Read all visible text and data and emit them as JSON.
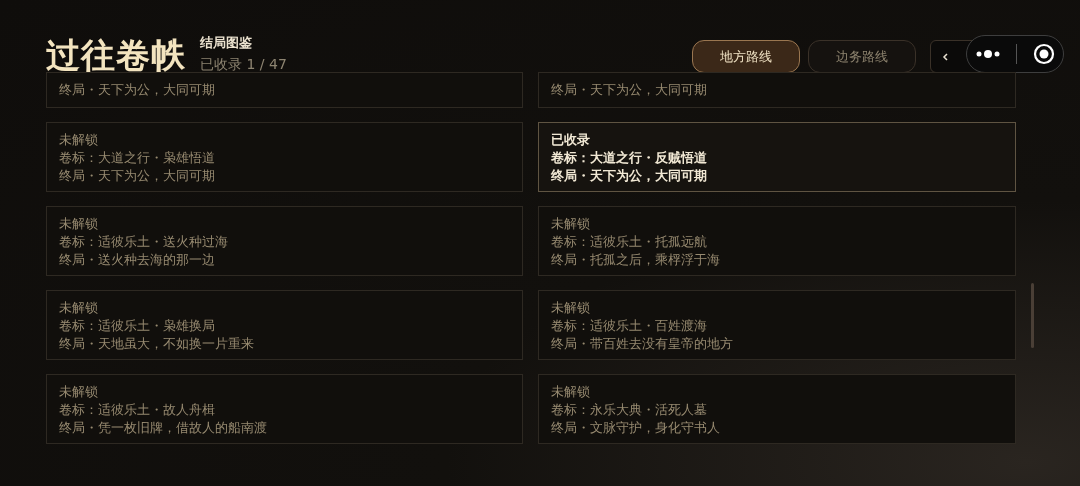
{
  "header": {
    "title": "过往卷帙",
    "subtitle": "结局图鉴",
    "progress": "已收录 1 / 47"
  },
  "tabs": [
    {
      "label": "地方路线",
      "selected": true
    },
    {
      "label": "边务路线",
      "selected": false
    }
  ],
  "cards": [
    {
      "kind": "clipped",
      "unlocked": false,
      "ending": "终局・天下为公，大同可期"
    },
    {
      "kind": "clipped",
      "unlocked": false,
      "ending": "终局・天下为公，大同可期"
    },
    {
      "kind": "full",
      "unlocked": false,
      "status": "未解锁",
      "volume": "卷标：大道之行・枭雄悟道",
      "ending": "终局・天下为公，大同可期"
    },
    {
      "kind": "full",
      "unlocked": true,
      "status": "已收录",
      "volume": "卷标：大道之行・反贼悟道",
      "ending": "终局・天下为公，大同可期"
    },
    {
      "kind": "full",
      "unlocked": false,
      "status": "未解锁",
      "volume": "卷标：适彼乐土・送火种过海",
      "ending": "终局・送火种去海的那一边"
    },
    {
      "kind": "full",
      "unlocked": false,
      "status": "未解锁",
      "volume": "卷标：适彼乐土・托孤远航",
      "ending": "终局・托孤之后，乘桴浮于海"
    },
    {
      "kind": "full",
      "unlocked": false,
      "status": "未解锁",
      "volume": "卷标：适彼乐土・枭雄换局",
      "ending": "终局・天地虽大，不如换一片重来"
    },
    {
      "kind": "full",
      "unlocked": false,
      "status": "未解锁",
      "volume": "卷标：适彼乐土・百姓渡海",
      "ending": "终局・带百姓去没有皇帝的地方"
    },
    {
      "kind": "full",
      "unlocked": false,
      "status": "未解锁",
      "volume": "卷标：适彼乐土・故人舟楫",
      "ending": "终局・凭一枚旧牌，借故人的船南渡"
    },
    {
      "kind": "full",
      "unlocked": false,
      "status": "未解锁",
      "volume": "卷标：永乐大典・活死人墓",
      "ending": "终局・文脉守护，身化守书人"
    }
  ]
}
